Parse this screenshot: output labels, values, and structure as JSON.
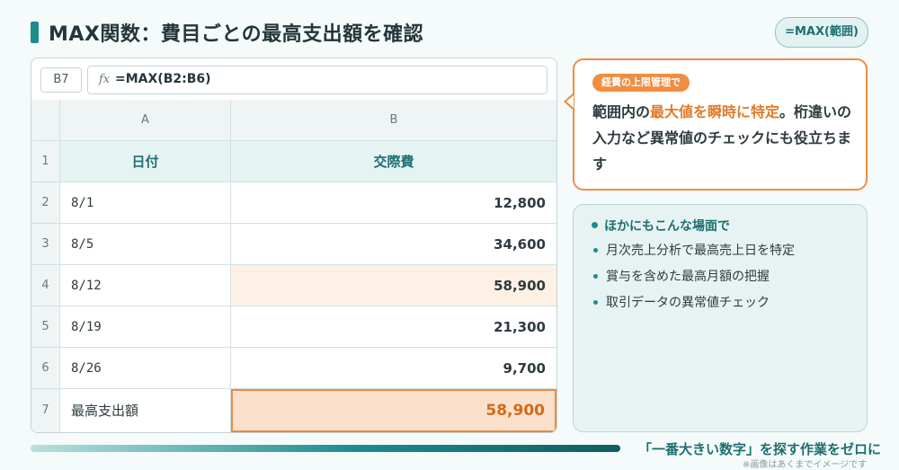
{
  "title": "MAX関数：費目ごとの最高支出額を確認",
  "formula_badge": "=MAX(範囲)",
  "spreadsheet": {
    "name_box": "B7",
    "fx_label": "fx",
    "formula": "=MAX(B2:B6)",
    "columns": [
      "A",
      "B"
    ],
    "header_row": {
      "row": "1",
      "a": "日付",
      "b": "交際費"
    },
    "rows": [
      {
        "row": "2",
        "date": "8/1",
        "amount": "12,800"
      },
      {
        "row": "3",
        "date": "8/5",
        "amount": "34,600"
      },
      {
        "row": "4",
        "date": "8/12",
        "amount": "58,900"
      },
      {
        "row": "5",
        "date": "8/19",
        "amount": "21,300"
      },
      {
        "row": "6",
        "date": "8/26",
        "amount": "9,700"
      }
    ],
    "result_row": {
      "row": "7",
      "label": "最高支出額",
      "value": "58,900"
    },
    "colors": {
      "highlight": "#fdf0e4",
      "result": "#fbe1cc",
      "accent": "#e88b42"
    }
  },
  "callout": {
    "tag": "経費の上限管理で",
    "text_prefix": "範囲内の",
    "text_emphasis": "最大値を瞬時に特定",
    "text_suffix": "。桁違いの入力など異常値のチェックにも役立ちます"
  },
  "uses": {
    "title": "ほかにもこんな場面で",
    "items": [
      "月次売上分析で最高売上日を特定",
      "賞与を含めた最高月額の把握",
      "取引データの異常値チェック"
    ]
  },
  "footer": {
    "tagline": "「一番大きい数字」を探す作業をゼロに",
    "disclaimer": "※画像はあくまでイメージです"
  }
}
